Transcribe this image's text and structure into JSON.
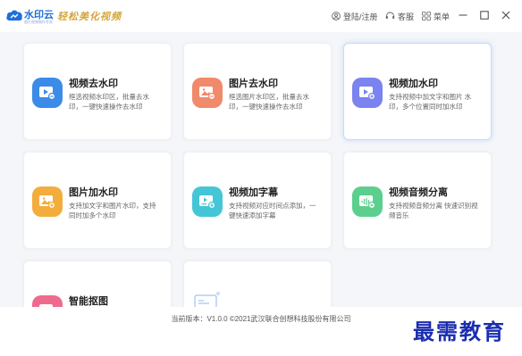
{
  "app": {
    "logo_name": "水印云",
    "logo_subtitle": "图片视频制作专家",
    "slogan": "轻松美化视频"
  },
  "titlebar": {
    "login_label": "登陆/注册",
    "service_label": "客服",
    "menu_label": "菜单"
  },
  "cards": [
    {
      "title": "视频去水印",
      "desc": "框选视频水印区，批量去水印，一键快速操作去水印",
      "color": "#3d8be8",
      "icon": "video-icon"
    },
    {
      "title": "图片去水印",
      "desc": "框选图片水印区，批量去水印，一键快速操作去水印",
      "color": "#f08a6a",
      "icon": "image-icon"
    },
    {
      "title": "视频加水印",
      "desc": "支持视频中加文字和图片 水印，多个位置同时加水印",
      "color": "#7a83ef",
      "icon": "video-icon"
    },
    {
      "title": "图片加水印",
      "desc": "支持加文字和图片水印，支持同时加多个水印",
      "color": "#f3ad3d",
      "icon": "image-icon"
    },
    {
      "title": "视频加字幕",
      "desc": "支持视频对应时间点添加，一键快速添加字幕",
      "color": "#45c6d6",
      "icon": "subtitle-icon"
    },
    {
      "title": "视频音频分离",
      "desc": "支持视频音频分离 快速识别视频音乐",
      "color": "#5ccf8e",
      "icon": "audio-icon"
    },
    {
      "title": "智能抠图",
      "desc": "",
      "color": "#ef6b8d",
      "icon": "cutout-icon"
    },
    {
      "title": "",
      "desc": "",
      "color": "#5a9be6",
      "icon": "illustration-icon"
    }
  ],
  "footer": {
    "version_text": "当前版本：V1.0.0 ©2021武汉联合创想科技股份有限公司"
  },
  "watermark_text": "最需教育"
}
